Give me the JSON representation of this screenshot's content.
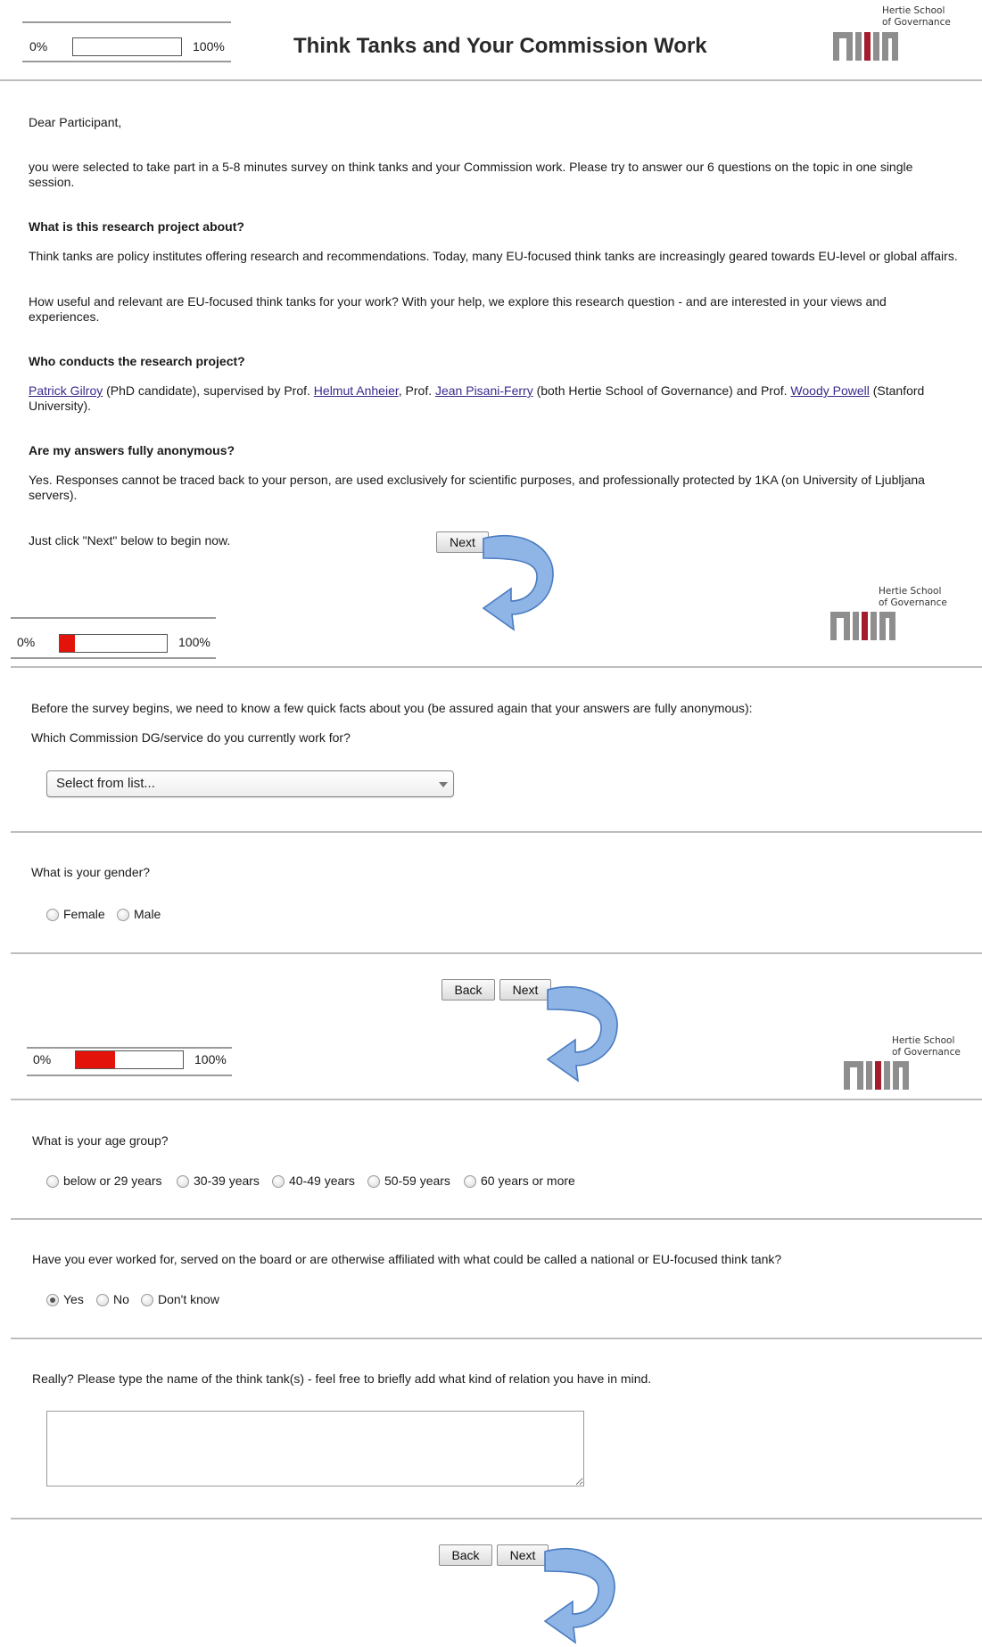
{
  "colors": {
    "progress_fill": "#e3120b",
    "link": "#3b2a8c",
    "logo_gray": "#8e8e8e",
    "logo_red": "#a31d2f",
    "arrow_fill": "#8fb4e6",
    "arrow_stroke": "#4a7cc0"
  },
  "icons": {
    "arrow": "curved-arrow-icon",
    "dropdown": "chevron-down-icon",
    "logo": "hertie-school-logo"
  },
  "screens": [
    {
      "progress": {
        "min_label": "0%",
        "max_label": "100%",
        "percent": 0
      },
      "title": "Think Tanks and Your Commission Work",
      "logo": {
        "line1": "Hertie School",
        "line2": "of Governance"
      },
      "greeting": "Dear Participant,",
      "intro": "you were selected to take part in a 5-8 minutes survey on think tanks and your Commission work. Please try to answer our 6 questions on the topic in one single session.",
      "sections": [
        {
          "heading": "What is this research project about?",
          "paragraphs": [
            "Think tanks are policy institutes offering research and recommendations. Today, many EU-focused think tanks are increasingly geared towards EU-level or global affairs.",
            "How useful and relevant are EU-focused think tanks for your work? With your help, we explore this research question - and are interested in your views and experiences."
          ]
        },
        {
          "heading": "Who conducts the research project?",
          "links": {
            "gilroy": "Patrick Gilroy",
            "anheier": "Helmut Anheier",
            "pisani": "Jean Pisani-Ferry",
            "powell": "Woody Powell"
          },
          "text": {
            "t1": " (PhD candidate), supervised by Prof. ",
            "t2": ", Prof. ",
            "t3": " (both Hertie School of Governance) and Prof. ",
            "t4": " (Stanford University)."
          }
        },
        {
          "heading": "Are my answers fully anonymous?",
          "paragraphs": [
            "Yes. Responses cannot be traced back to your person, are used exclusively for scientific purposes, and professionally protected by 1KA (on University of Ljubljana servers)."
          ]
        }
      ],
      "begin_text": "Just click \"Next\" below to begin now.",
      "next_label": "Next"
    },
    {
      "progress": {
        "min_label": "0%",
        "max_label": "100%",
        "percent": 14
      },
      "logo": {
        "line1": "Hertie School",
        "line2": "of Governance"
      },
      "intro": "Before the survey begins, we need to know a few quick facts about you (be assured again that your answers are fully anonymous):",
      "q_dg": "Which Commission DG/service do you currently work for?",
      "dg_select": "Select from list...",
      "q_gender": "What is your gender?",
      "gender_options": [
        "Female",
        "Male"
      ],
      "back_label": "Back",
      "next_label": "Next"
    },
    {
      "progress": {
        "min_label": "0%",
        "max_label": "100%",
        "percent": 37
      },
      "logo": {
        "line1": "Hertie School",
        "line2": "of Governance"
      },
      "q_age": "What is your age group?",
      "age_options": [
        "below or 29 years",
        "30-39 years",
        "40-49 years",
        "50-59 years",
        "60 years or more"
      ],
      "q_affiliation": "Have you ever worked for, served on the board or are otherwise affiliated with what could be called a national or EU-focused think tank?",
      "affiliation_options": [
        "Yes",
        "No",
        "Don't know"
      ],
      "affiliation_selected": "Yes",
      "q_name": "Really? Please type the name of the think tank(s) - feel free to briefly add what kind of relation you have in mind.",
      "name_value": "",
      "back_label": "Back",
      "next_label": "Next"
    }
  ]
}
